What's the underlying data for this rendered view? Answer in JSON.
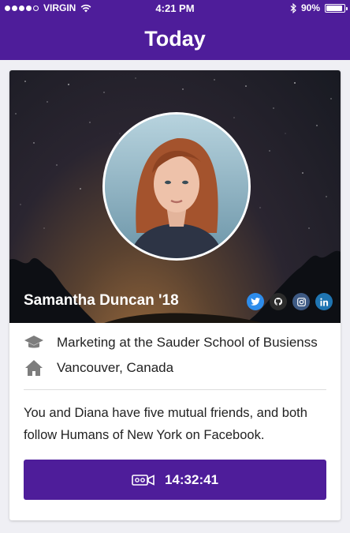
{
  "status_bar": {
    "carrier": "VIRGIN",
    "time": "4:21 PM",
    "battery": "90%",
    "battery_level": 0.9,
    "icons": [
      "signal-dots-icon",
      "wifi-icon",
      "bluetooth-icon",
      "battery-icon"
    ]
  },
  "nav": {
    "title": "Today"
  },
  "profile": {
    "name": "Samantha Duncan '18",
    "socials": [
      "twitter-icon",
      "github-icon",
      "instagram-icon",
      "linkedin-icon"
    ],
    "occupation": "Marketing at the Sauder School of Busienss",
    "location": "Vancouver, Canada",
    "description": "You and Diana have five mutual friends, and both follow Humans of New York on Facebook."
  },
  "timer": {
    "label": "14:32:41",
    "icon": "video-camera-icon"
  },
  "colors": {
    "brand": "#4e1d9a",
    "twitter": "#2d8ceb",
    "linkedin": "#1f75b2"
  }
}
